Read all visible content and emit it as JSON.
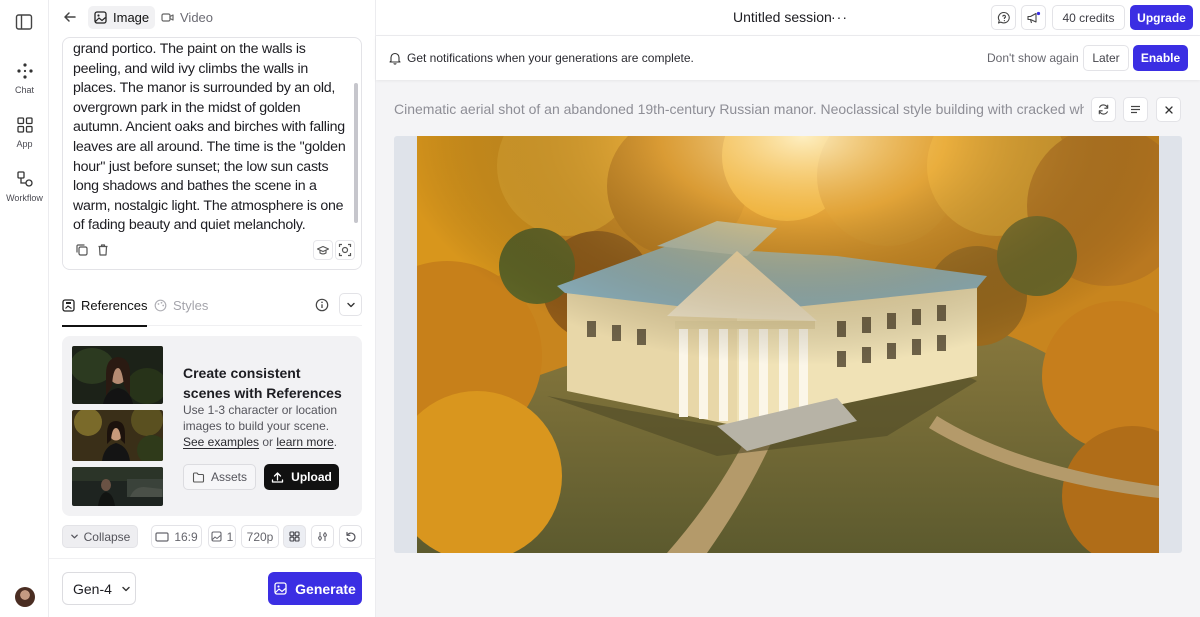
{
  "rail": {
    "items": [
      {
        "label": "Chat",
        "icon": "chat-dots-icon"
      },
      {
        "label": "App",
        "icon": "app-grid-icon"
      },
      {
        "label": "Workflow",
        "icon": "workflow-icon"
      }
    ]
  },
  "panel": {
    "mode_tabs": [
      {
        "label": "Image",
        "active": true
      },
      {
        "label": "Video",
        "active": false
      }
    ],
    "prompt_text": "grand portico. The paint on the walls is peeling, and wild ivy climbs the walls in places. The manor is surrounded by an old, overgrown park in the midst of golden autumn. Ancient oaks and birches with falling leaves are all around. The time is the \"golden hour\" just before sunset; the low sun casts long shadows and bathes the scene in a warm, nostalgic light. The atmosphere is one of fading beauty and quiet melancholy.",
    "tabs": {
      "references": "References",
      "styles": "Styles"
    },
    "references_card": {
      "title": "Create consistent scenes with References",
      "desc_prefix": "Use 1-3 character or location images to build your scene. ",
      "link_examples": "See examples",
      "desc_or": " or ",
      "link_learn": "learn more",
      "desc_suffix": ".",
      "assets_label": "Assets",
      "upload_label": "Upload"
    },
    "settings": {
      "collapse_label": "Collapse",
      "aspect_ratio": "16:9",
      "image_count": "1",
      "resolution": "720p"
    },
    "model": "Gen-4",
    "generate_label": "Generate"
  },
  "header": {
    "session_title": "Untitled session",
    "more": "···",
    "credits": "40 credits",
    "upgrade": "Upgrade"
  },
  "notification": {
    "text": "Get notifications when your generations are complete.",
    "dont_show": "Don't show again",
    "later": "Later",
    "enable": "Enable"
  },
  "generation": {
    "prompt_preview": "Cinematic aerial shot of an abandoned 19th-century Russian manor. Neoclassical style building with cracked white col..."
  },
  "colors": {
    "accent": "#3b2ee3",
    "primary_dark": "#111111",
    "main_bg": "#f4f4f6"
  }
}
